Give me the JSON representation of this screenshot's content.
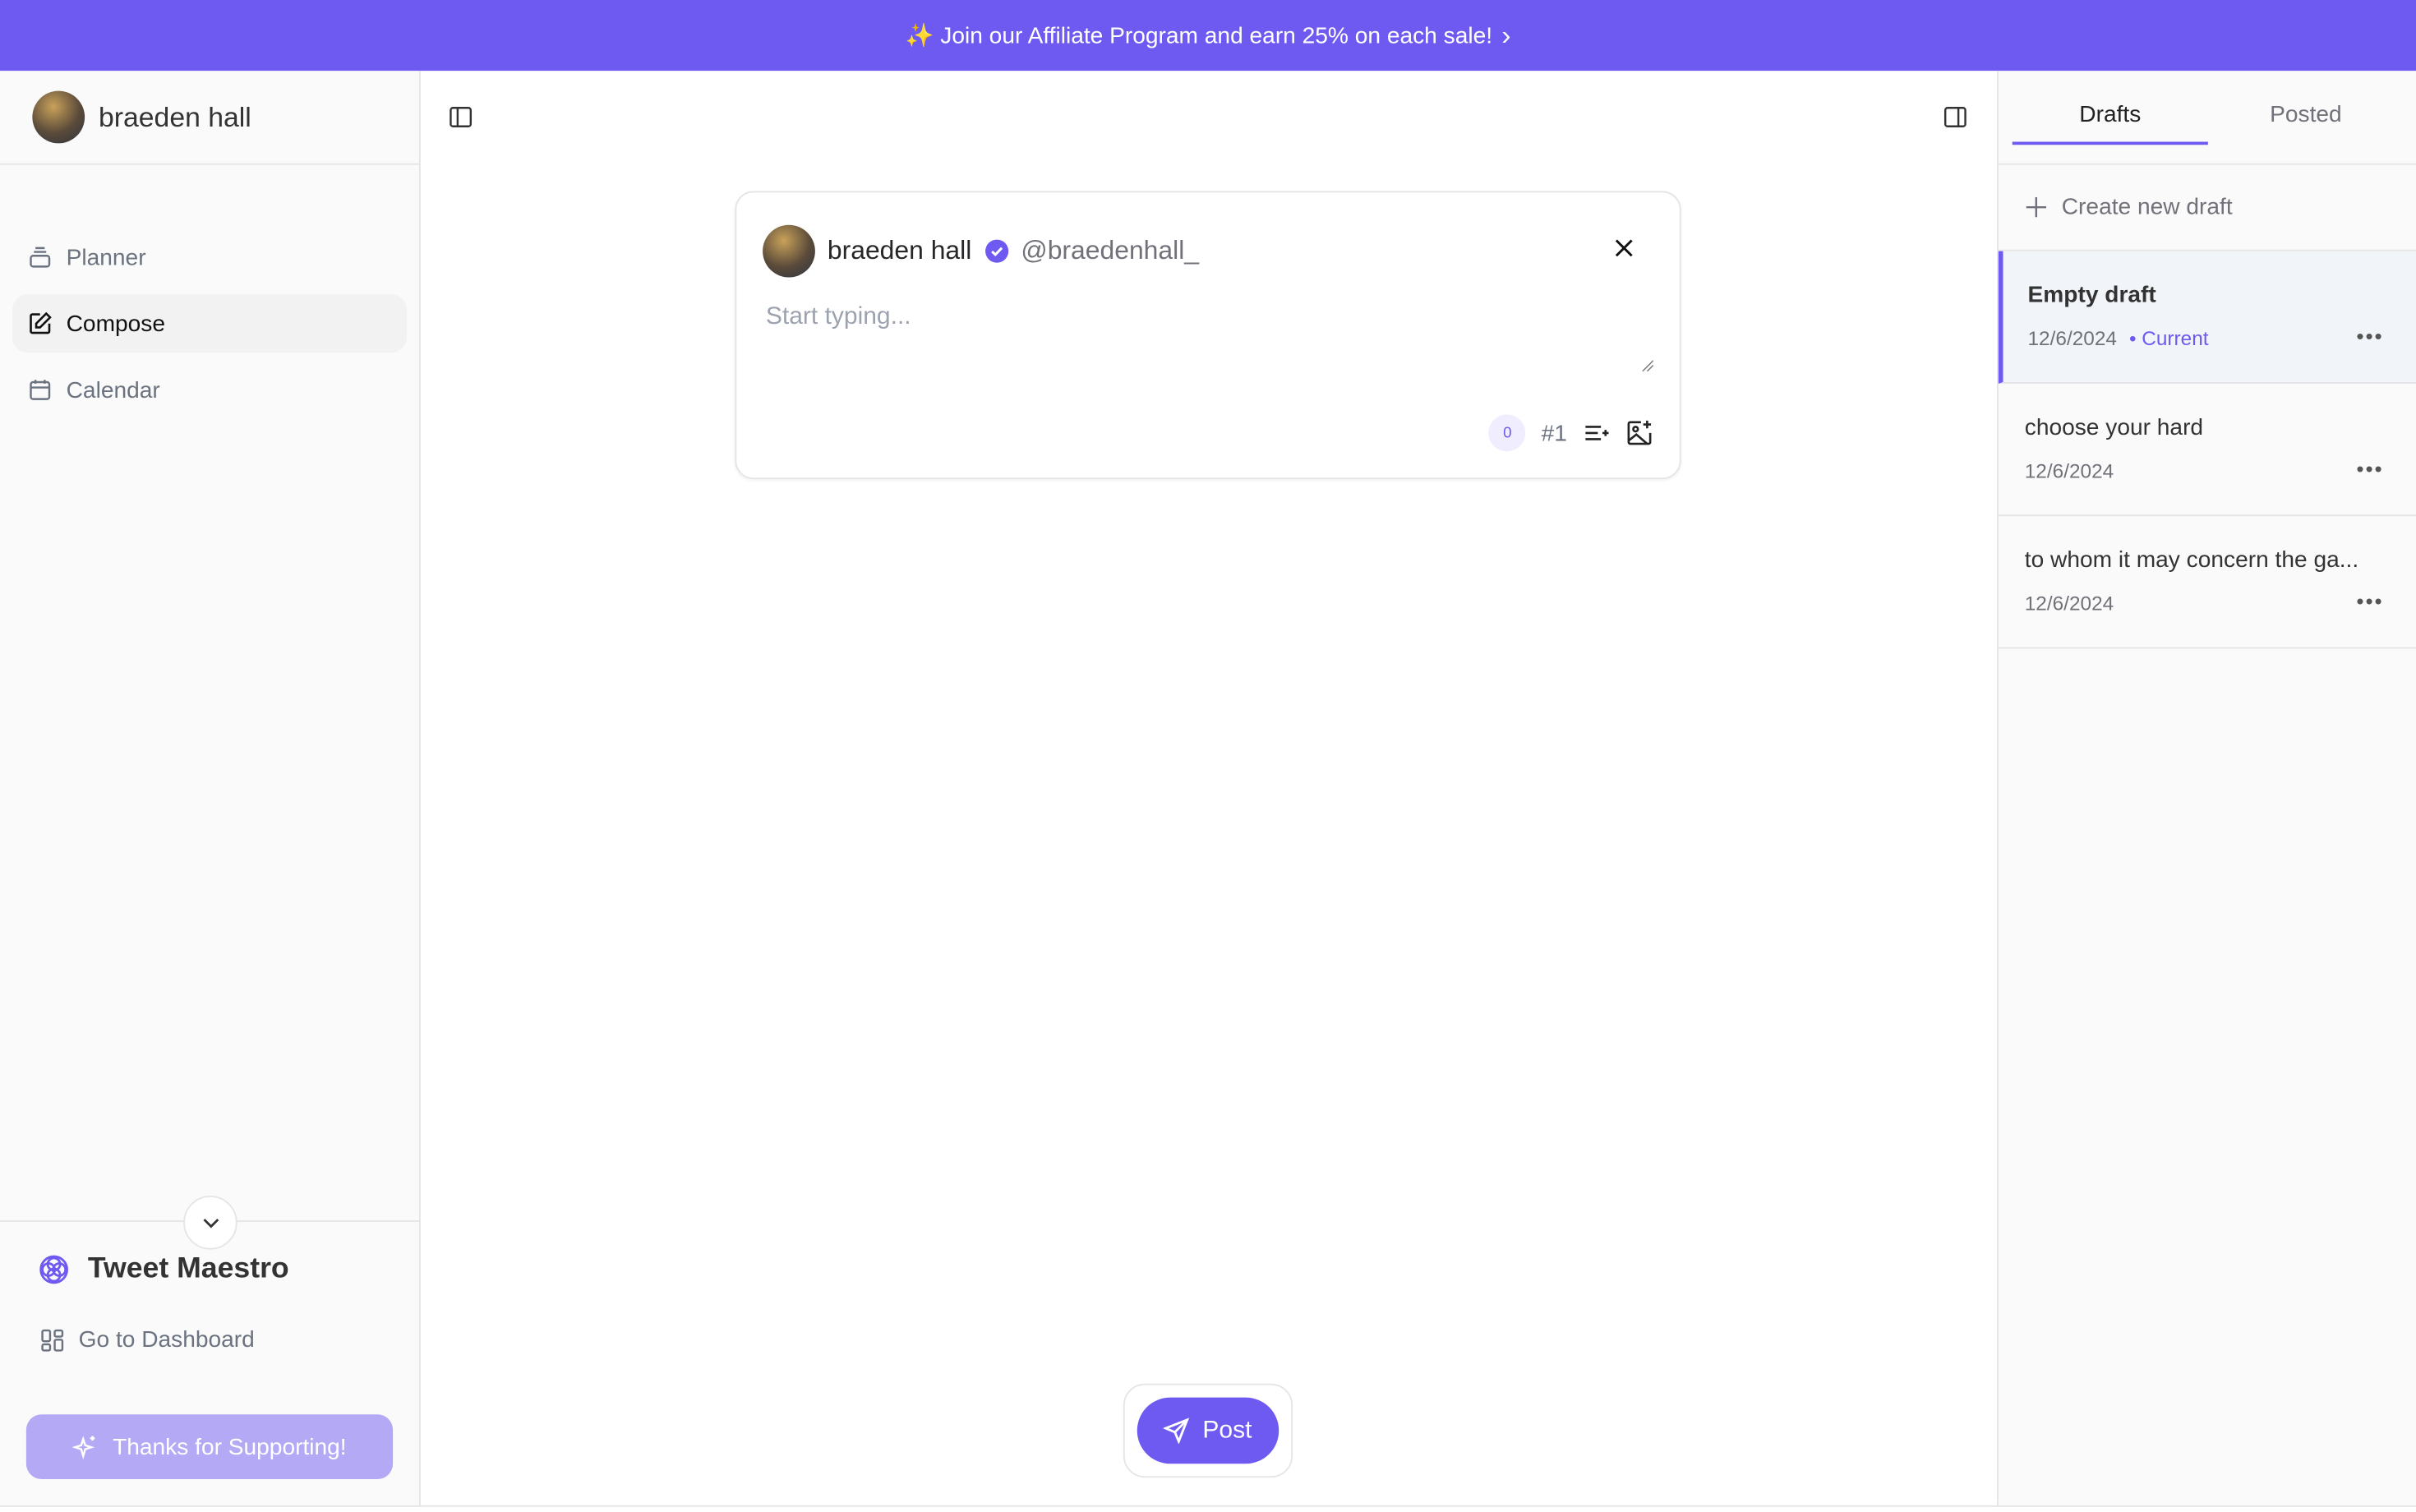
{
  "banner": {
    "icon": "sparkles-icon",
    "text": "✨ Join our Affiliate Program and earn 25% on each sale!",
    "arrow": "›"
  },
  "sidebar": {
    "user": {
      "name": "braeden hall"
    },
    "nav": [
      {
        "label": "Planner",
        "icon": "stack-icon"
      },
      {
        "label": "Compose",
        "icon": "edit-icon",
        "active": true
      },
      {
        "label": "Calendar",
        "icon": "calendar-icon"
      }
    ],
    "brand": "Tweet Maestro",
    "dashboard_label": "Go to Dashboard",
    "support_label": "Thanks for Supporting!"
  },
  "composer": {
    "name": "braeden hall",
    "handle": "@braedenhall_",
    "placeholder": "Start typing...",
    "char_count": "0",
    "thread_number": "#1",
    "post_label": "Post"
  },
  "drafts_panel": {
    "tabs": [
      "Drafts",
      "Posted"
    ],
    "create_label": "Create new draft",
    "items": [
      {
        "title": "Empty draft",
        "date": "12/6/2024",
        "current": "• Current"
      },
      {
        "title": "choose your hard",
        "date": "12/6/2024"
      },
      {
        "title": "to whom it may concern the ga...",
        "date": "12/6/2024"
      }
    ]
  },
  "colors": {
    "accent": "#6e5af0",
    "support": "#b4a9f5"
  }
}
